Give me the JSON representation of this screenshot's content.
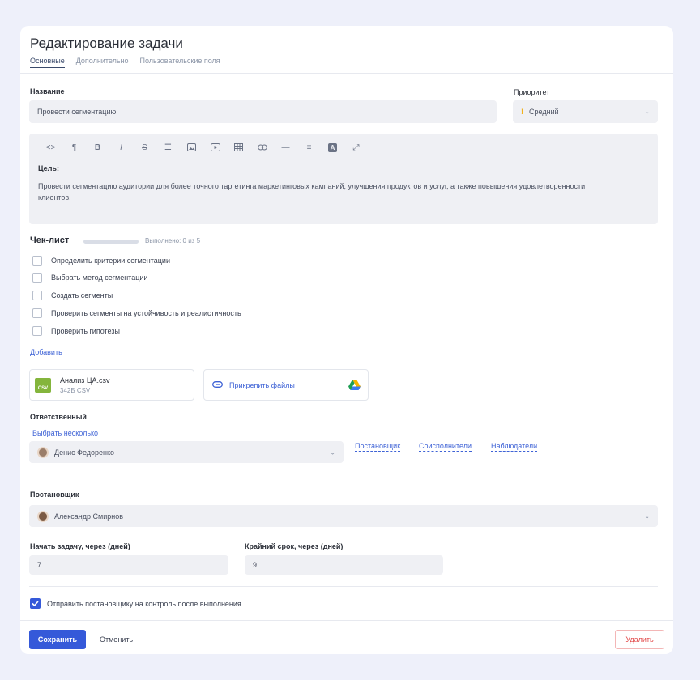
{
  "header": {
    "title": "Редактирование задачи",
    "tabs": [
      {
        "label": "Основные"
      },
      {
        "label": "Дополнительно"
      },
      {
        "label": "Пользовательские поля"
      }
    ]
  },
  "name": {
    "label": "Название",
    "value": "Провести сегментацию"
  },
  "priority": {
    "label": "Приоритет",
    "value": "Средний",
    "icon": "exclamation-icon",
    "color": "#f2b21c"
  },
  "editor": {
    "toolbar": [
      "code-icon",
      "paragraph-icon",
      "bold-icon",
      "italic-icon",
      "strikethrough-icon",
      "list-icon",
      "image-icon",
      "video-icon",
      "table-icon",
      "link-icon",
      "hr-icon",
      "align-icon",
      "text-color-icon",
      "expand-icon"
    ],
    "heading": "Цель:",
    "body": "Провести сегментацию аудитории для более точного таргетинга маркетинговых кампаний, улучшения продуктов и услуг, а также повышения удовлетворенности клиентов."
  },
  "checklist": {
    "title": "Чек-лист",
    "progress_text": "Выполнено: 0 из 5",
    "progress": 0,
    "items": [
      {
        "label": "Определить критерии сегментации",
        "checked": false
      },
      {
        "label": "Выбрать метод сегментации",
        "checked": false
      },
      {
        "label": "Создать сегменты",
        "checked": false
      },
      {
        "label": "Проверить сегменты на устойчивость и реалистичность",
        "checked": false
      },
      {
        "label": "Проверить гипотезы",
        "checked": false
      }
    ],
    "add_label": "Добавить"
  },
  "files": {
    "file_name": "Анализ ЦА.csv",
    "file_meta": "342Б CSV",
    "file_badge": "CSV",
    "attach_label": "Прикрепить файлы"
  },
  "responsible": {
    "label": "Ответственный",
    "select_multiple": "Выбрать несколько",
    "value": "Денис Федоренко",
    "links": [
      "Постановщик",
      "Соисполнители",
      "Наблюдатели"
    ]
  },
  "assigner": {
    "label": "Постановщик",
    "value": "Александр Смирнов"
  },
  "start": {
    "label": "Начать задачу, через (дней)",
    "value": "7"
  },
  "deadline": {
    "label": "Крайний срок, через (дней)",
    "value": "9"
  },
  "control": {
    "label": "Отправить постановщику на контроль после выполнения",
    "checked": true
  },
  "footer": {
    "save": "Сохранить",
    "cancel": "Отменить",
    "delete": "Удалить"
  },
  "colors": {
    "accent": "#3559d9",
    "danger": "#e24a4a",
    "csv": "#84b53c"
  }
}
